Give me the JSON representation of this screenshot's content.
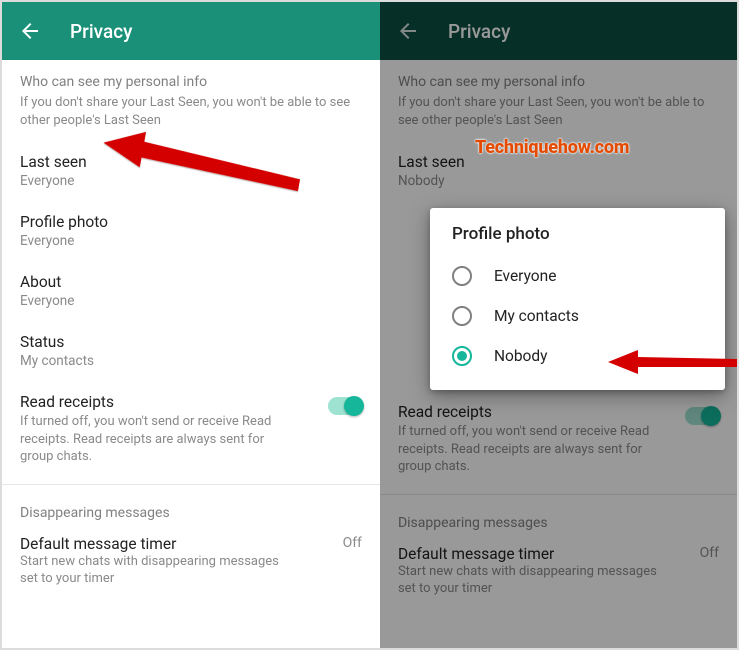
{
  "header": {
    "title": "Privacy"
  },
  "section": {
    "heading": "Who can see my personal info",
    "desc": "If you don't share your Last Seen, you won't be able to see other people's Last Seen"
  },
  "items": {
    "lastSeen": {
      "title": "Last seen",
      "value_left": "Everyone",
      "value_right": "Nobody"
    },
    "profilePhoto": {
      "title": "Profile photo",
      "value": "Everyone"
    },
    "about": {
      "title": "About",
      "value": "Everyone"
    },
    "status": {
      "title": "Status",
      "value": "My contacts"
    }
  },
  "readReceipts": {
    "title": "Read receipts",
    "desc": "If turned off, you won't send or receive Read receipts. Read receipts are always sent for group chats."
  },
  "disappearing": {
    "heading": "Disappearing messages",
    "timer_title": "Default message timer",
    "timer_desc": "Start new chats with disappearing messages set to your timer",
    "timer_value": "Off"
  },
  "dialog": {
    "title": "Profile photo",
    "options": [
      "Everyone",
      "My contacts",
      "Nobody"
    ],
    "selected": "Nobody"
  },
  "watermark": "Techniquehow.com"
}
